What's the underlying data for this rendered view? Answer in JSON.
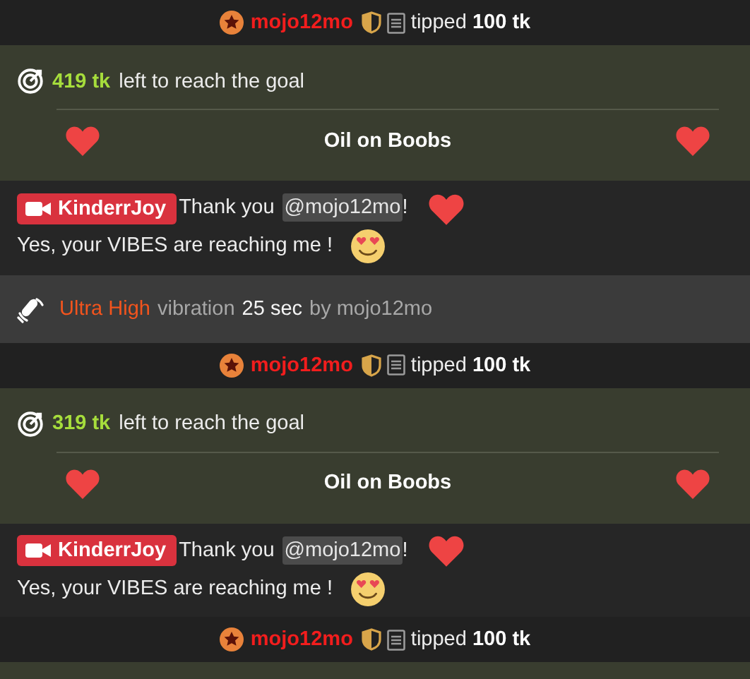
{
  "feed": [
    {
      "kind": "tip",
      "user": "mojo12mo",
      "text": "tipped **100 tk**"
    },
    {
      "kind": "goal",
      "amount": "419 tk",
      "text": "left to reach the goal",
      "title": "Oil on Boobs"
    },
    {
      "kind": "message",
      "user": "KinderrJoy",
      "before": "Thank you",
      "mention": "@mojo12mo",
      "after": "!",
      "rest": [
        "Yes, your VIBES are",
        "reaching me !"
      ]
    },
    {
      "kind": "vibration",
      "strength": "Ultra High",
      "text": "vibration",
      "duration": "25 sec",
      "by": "by mojo12mo"
    },
    {
      "kind": "tip",
      "user": "mojo12mo",
      "text": "tipped **100 tk**"
    },
    {
      "kind": "goal",
      "amount": "319 tk",
      "text": "left to reach the goal",
      "title": "Oil on Boobs"
    },
    {
      "kind": "message",
      "user": "KinderrJoy",
      "before": "Thank you",
      "mention": "@mojo12mo",
      "after": "!",
      "rest": [
        "Yes, your VIBES are",
        "reaching me !"
      ]
    },
    {
      "kind": "tip",
      "user": "mojo12mo",
      "text": "tipped **100 tk**"
    }
  ]
}
